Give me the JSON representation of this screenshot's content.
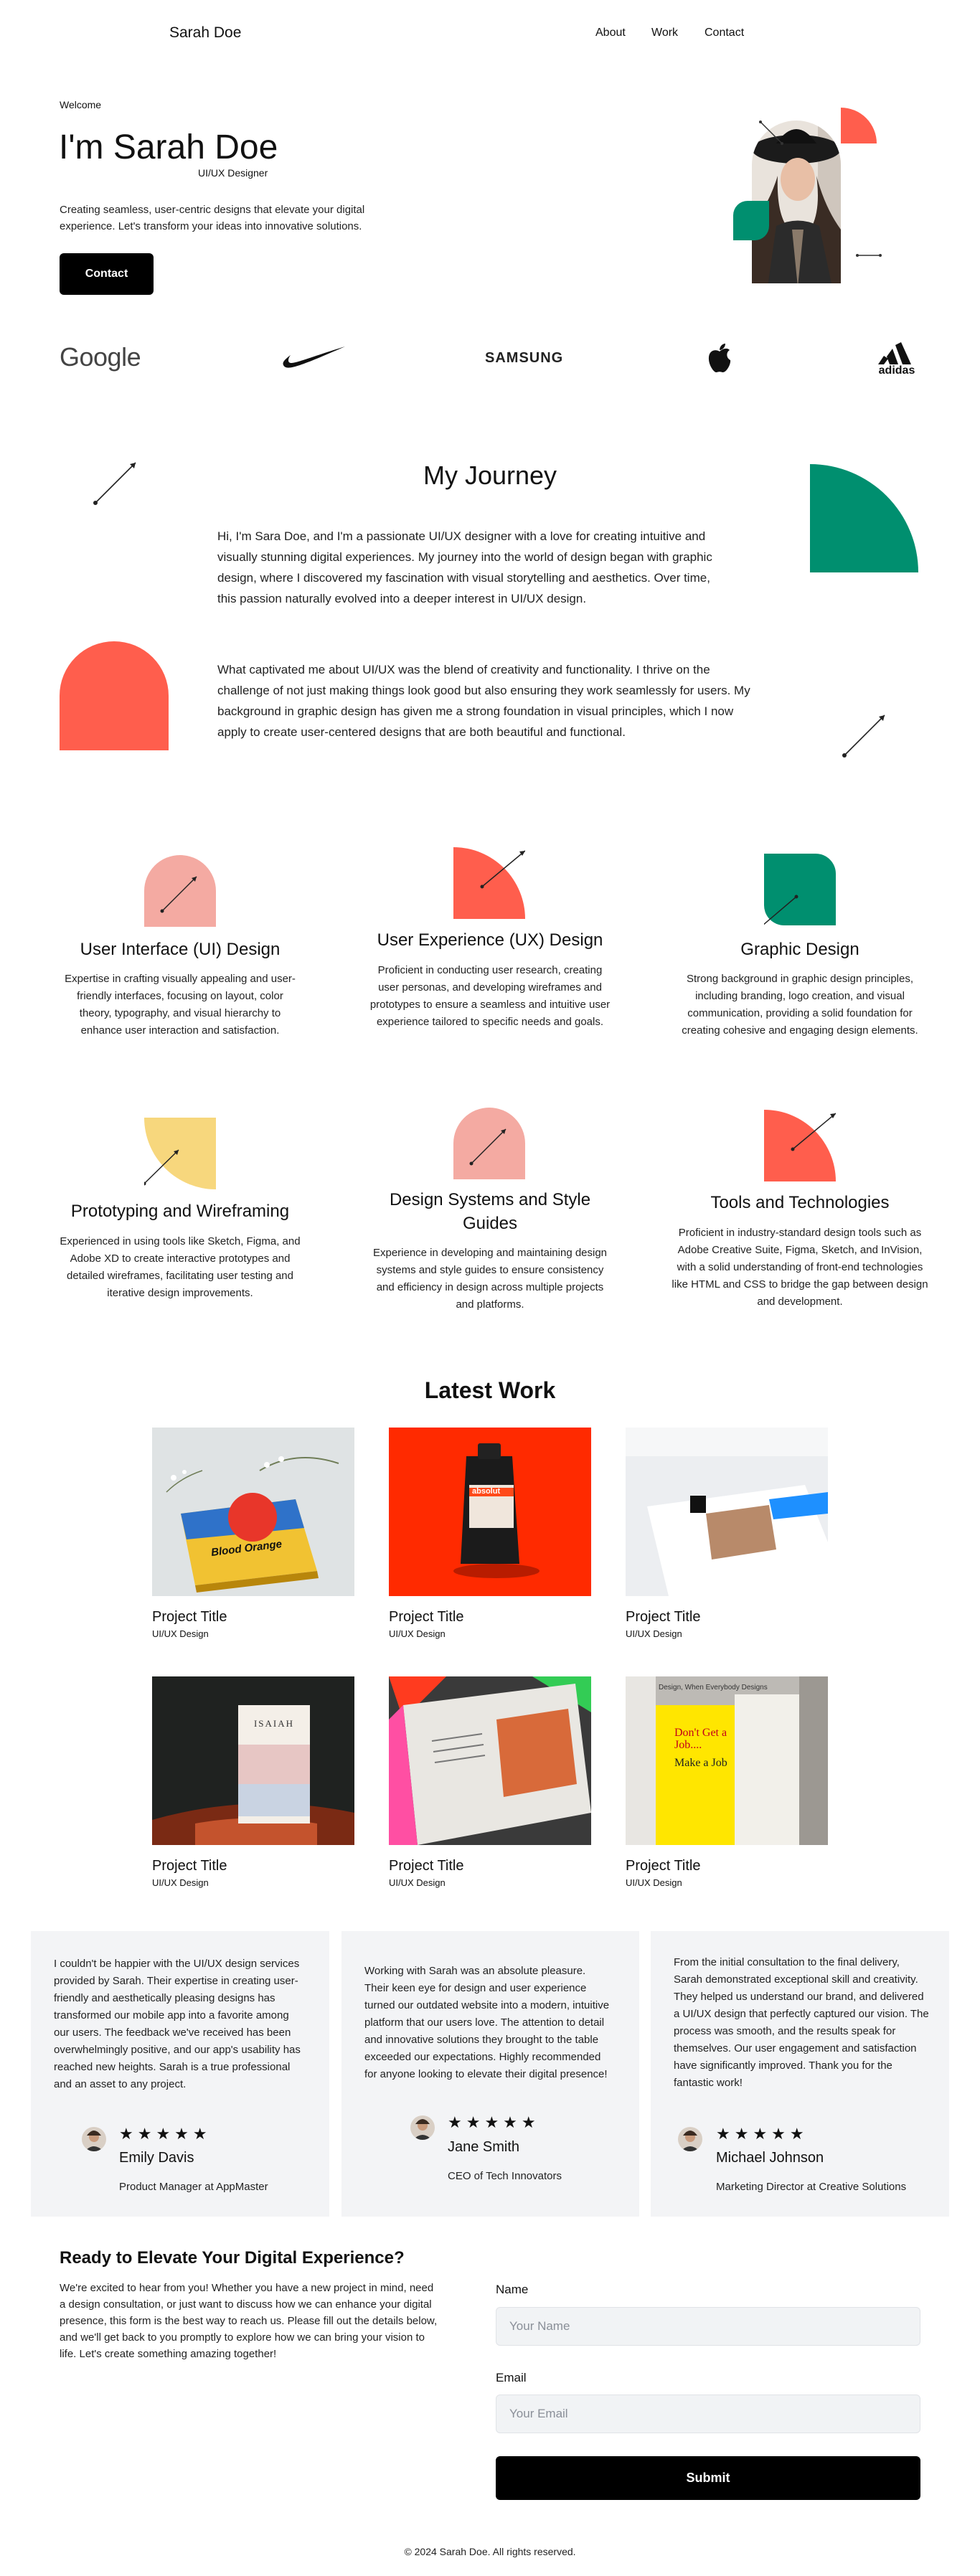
{
  "header": {
    "brand": "Sarah Doe",
    "nav": [
      "About",
      "Work",
      "Contact"
    ]
  },
  "hero": {
    "welcome": "Welcome",
    "title": "I'm Sarah Doe",
    "subtitle": "UI/UX Designer",
    "description": "Creating seamless, user-centric designs that elevate your digital experience. Let's transform your ideas into innovative solutions.",
    "cta": "Contact"
  },
  "clients": {
    "google": "Google",
    "samsung": "SAMSUNG",
    "adidas": "adidas"
  },
  "journey": {
    "title": "My Journey",
    "p1": "Hi, I'm Sara Doe, and I'm a passionate UI/UX designer with a love for creating intuitive and visually stunning digital experiences. My journey into the world of design began with graphic design, where I discovered my fascination with visual storytelling and aesthetics. Over time, this passion naturally evolved into a deeper interest in UI/UX design.",
    "p2": "What captivated me about UI/UX was the blend of creativity and functionality. I thrive on the challenge of not just making things look good but also ensuring they work seamlessly for users. My background in graphic design has given me a strong foundation in visual principles, which I now apply to create user-centered designs that are both beautiful and functional."
  },
  "services": [
    {
      "title": "User Interface (UI) Design",
      "desc": "Expertise in crafting visually appealing and user-friendly interfaces, focusing on layout, color theory, typography, and visual hierarchy to enhance user interaction and satisfaction."
    },
    {
      "title": "User Experience (UX) Design",
      "desc": "Proficient in conducting user research, creating user personas, and developing wireframes and prototypes to ensure a seamless and intuitive user experience tailored to specific needs and goals."
    },
    {
      "title": "Graphic Design",
      "desc": "Strong background in graphic design principles, including branding, logo creation, and visual communication, providing a solid foundation for creating cohesive and engaging design elements."
    },
    {
      "title": "Prototyping and Wireframing",
      "desc": "Experienced in using tools like Sketch, Figma, and Adobe XD to create interactive prototypes and detailed wireframes, facilitating user testing and iterative design improvements."
    },
    {
      "title": "Design Systems and Style Guides",
      "desc": "Experience in developing and maintaining design systems and style guides to ensure consistency and efficiency in design across multiple projects and platforms."
    },
    {
      "title": "Tools and Technologies",
      "desc": "Proficient in industry-standard design tools such as Adobe Creative Suite, Figma, Sketch, and InVision, with a solid understanding of front-end technologies like HTML and CSS to bridge the gap between design and development."
    }
  ],
  "work": {
    "title": "Latest Work",
    "items": [
      {
        "title": "Project Title",
        "category": "UI/UX Design"
      },
      {
        "title": "Project Title",
        "category": "UI/UX Design"
      },
      {
        "title": "Project Title",
        "category": "UI/UX Design"
      },
      {
        "title": "Project Title",
        "category": "UI/UX Design"
      },
      {
        "title": "Project Title",
        "category": "UI/UX Design"
      },
      {
        "title": "Project Title",
        "category": "UI/UX Design"
      }
    ],
    "image_text": {
      "book1": "Blood Orange",
      "pouch": "absolut",
      "book4": "ISAIAH",
      "yellow_line1": "Don't Get a Job....",
      "yellow_line2": "Make a Job",
      "spine_title": "Design, When Everybody Designs"
    }
  },
  "testimonials": [
    {
      "quote": "I couldn't be happier with the UI/UX design services provided by Sarah. Their expertise in creating user-friendly and aesthetically pleasing designs has transformed our mobile app into a favorite among our users. The feedback we've received has been overwhelmingly positive, and our app's usability has reached new heights. Sarah is a true professional and an asset to any project.",
      "stars": "★★★★★",
      "name": "Emily Davis",
      "role": "Product Manager at AppMaster"
    },
    {
      "quote": "Working with Sarah was an absolute pleasure. Their keen eye for design and user experience turned our outdated website into a modern, intuitive platform that our users love. The attention to detail and innovative solutions they brought to the table exceeded our expectations. Highly recommended for anyone looking to elevate their digital presence!",
      "stars": "★★★★★",
      "name": "Jane Smith",
      "role": "CEO of Tech Innovators"
    },
    {
      "quote": "From the initial consultation to the final delivery, Sarah demonstrated exceptional skill and creativity. They helped us understand our brand, and delivered a UI/UX design that perfectly captured our vision. The process was smooth, and the results speak for themselves. Our user engagement and satisfaction have significantly improved. Thank you for the fantastic work!",
      "stars": "★★★★★",
      "name": "Michael Johnson",
      "role": "Marketing Director at Creative Solutions"
    }
  ],
  "contact": {
    "title": "Ready to Elevate Your Digital Experience?",
    "description": "We're excited to hear from you! Whether you have a new project in mind, need a design consultation, or just want to discuss how we can enhance your digital presence, this form is the best way to reach us. Please fill out the details below, and we'll get back to you promptly to explore how we can bring your vision to life. Let's create something amazing together!",
    "name_label": "Name",
    "name_placeholder": "Your Name",
    "email_label": "Email",
    "email_placeholder": "Your Email",
    "submit": "Submit"
  },
  "footer": {
    "text": "© 2024 Sarah Doe. All rights reserved."
  },
  "colors": {
    "coral": "#ff5e4d",
    "green": "#008f6f",
    "pink": "#f4aaa2",
    "yellow": "#f7d77d",
    "dark": "#000000",
    "card_bg": "#f3f4f6"
  },
  "icons": [
    "google-logo",
    "nike-swoosh-logo",
    "samsung-logo",
    "apple-logo",
    "adidas-logo",
    "star-icon"
  ]
}
